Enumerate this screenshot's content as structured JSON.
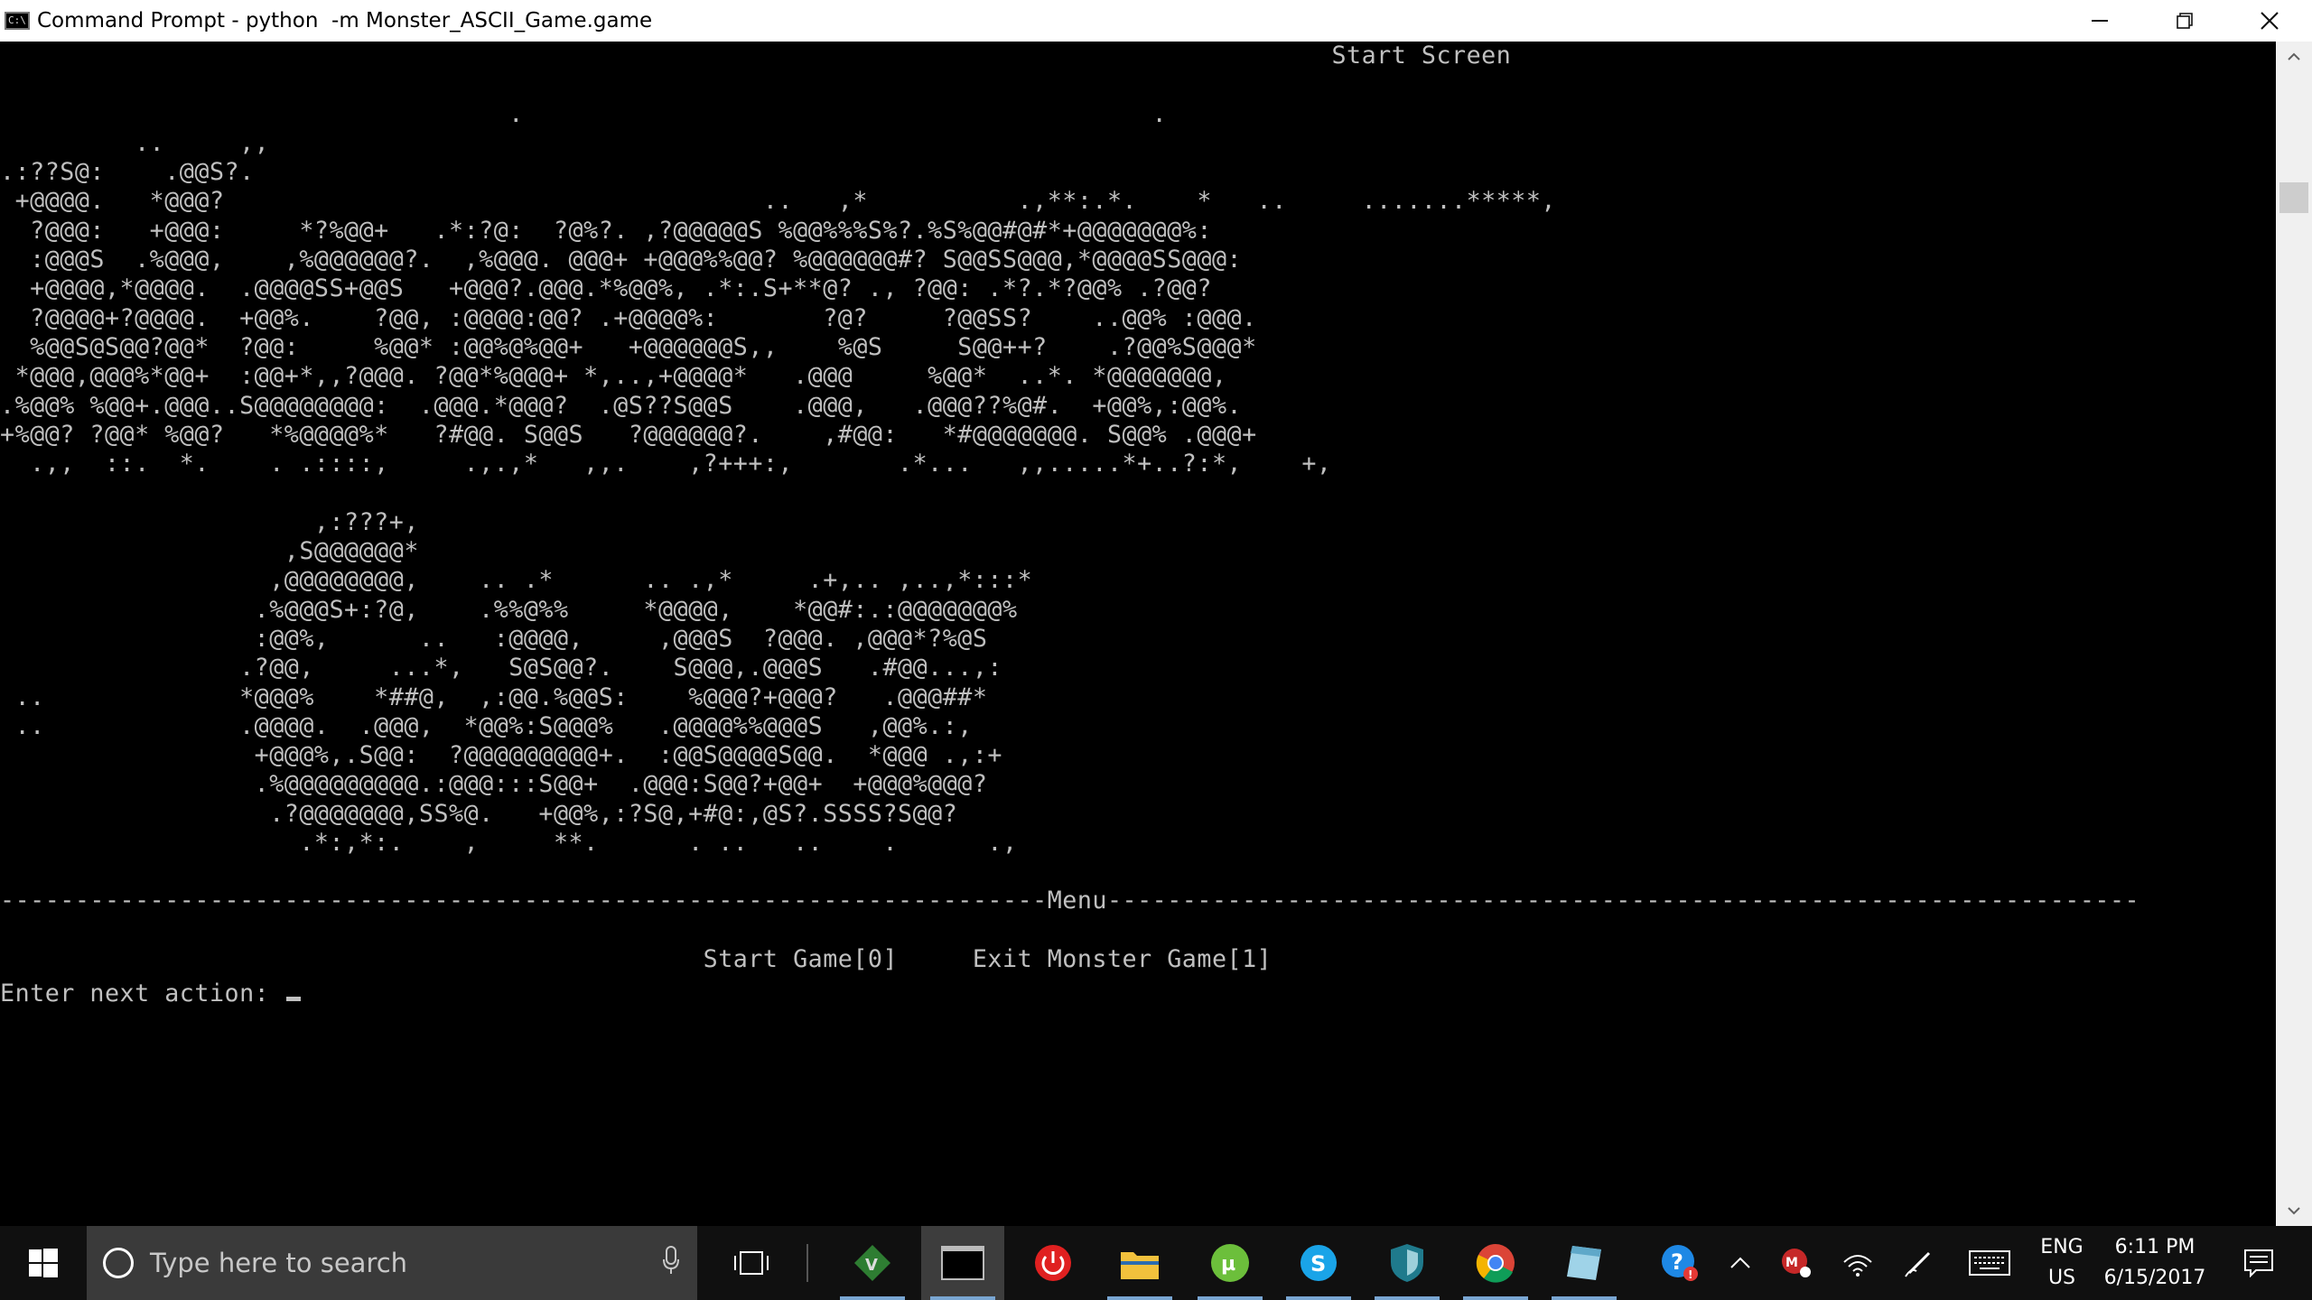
{
  "window": {
    "title": "Command Prompt - python  -m Monster_ASCII_Game.game",
    "app_icon_text": "C:\\",
    "controls": {
      "minimize_icon": "minimize-icon",
      "restore_icon": "restore-icon",
      "close_icon": "close-icon"
    }
  },
  "console": {
    "screen_title": "                                                                                         Start Screen",
    "art_top": "\n                                  .                                          .\n         ..     ,,\n.:??S@:    .@@S?.\n +@@@@.   *@@@?                                    ..   ,*          .,**:.*.    *   ..     .......*****,\n  ?@@@:   +@@@:     *?%@@+   .*:?@:  ?@%?. ,?@@@@@S %@@%%%S%?.%S%@@#@#*+@@@@@@@%:\n  :@@@S  .%@@@,    ,%@@@@@@?.  ,%@@@. @@@+ +@@@%%@@? %@@@@@@#? S@@SS@@@,*@@@@SS@@@:\n  +@@@@,*@@@@.  .@@@@SS+@@S   +@@@?.@@@.*%@@%, .*:.S+**@? ., ?@@: .*?.*?@@% .?@@?\n  ?@@@@+?@@@@.  +@@%.    ?@@, :@@@@:@@? .+@@@@%:       ?@?     ?@@SS?    ..@@% :@@@.\n  %@@S@S@@?@@*  ?@@:     %@@* :@@%@%@@+   +@@@@@@S,,    %@S     S@@++?    .?@@%S@@@*\n *@@@,@@@%*@@+  :@@+*,,?@@@. ?@@*%@@@+ *,..,+@@@@*   .@@@     %@@*  ..*. *@@@@@@@,\n.%@@% %@@+.@@@..S@@@@@@@@:  .@@@.*@@@?  .@S??S@@S    .@@@,   .@@@??%@#.  +@@%,:@@%.\n+%@@? ?@@* %@@?   *%@@@@%*   ?#@@. S@@S   ?@@@@@@?.    ,#@@:   *#@@@@@@@. S@@% .@@@+\n  .,,  ::.  *.    . .::::,     .,.,*   ,,.    ,?+++:,       .*...   ,,.....*+..?:*,    +,",
    "art_bottom": "\n                     ,:???+,\n                   ,S@@@@@@*\n                  ,@@@@@@@@,    .. .*      .. .,*     .+,.. ,..,*:::*\n                 .%@@@S+:?@,    .%%@%%     *@@@@,    *@@#:.:@@@@@@@%\n                 :@@%,      ..   :@@@@,     ,@@@S  ?@@@. ,@@@*?%@S\n                .?@@,     ...*,   S@S@@?.    S@@@,.@@@S   .#@@...,:\n ..             *@@@%    *##@,  ,:@@.%@@S:    %@@@?+@@@?   .@@@##*\n ..             .@@@@.  .@@@,  *@@%:S@@@%   .@@@@%%@@@S   ,@@%.:,\n                 +@@@%,.S@@:  ?@@@@@@@@@+.  :@@S@@@@S@@.  *@@@ .,:+\n                 .%@@@@@@@@@.:@@@:::S@@+  .@@@:S@@?+@@+  +@@@%@@@?\n                  .?@@@@@@@,SS%@.   +@@%,:?S@,+#@:,@S?.SSSS?S@@?\n                    .*:,*:.    ,     **.      . ..   ..    .      .,",
    "menu_rule": "----------------------------------------------------------------------Menu---------------------------------------------------------------------",
    "menu_options": "                                               Start Game[0]     Exit Monster Game[1]",
    "prompt": "Enter next action: "
  },
  "scrollbar": {
    "up_icon": "scroll-up-icon",
    "down_icon": "scroll-down-icon"
  },
  "taskbar": {
    "search_placeholder": "Type here to search",
    "apps": [
      "vim",
      "command-prompt",
      "power",
      "file-explorer",
      "utorrent",
      "skype",
      "windows-defender",
      "chrome",
      "notepad"
    ],
    "tray": {
      "language_line1": "ENG",
      "language_line2": "US",
      "time": "6:11 PM",
      "date": "6/15/2017"
    }
  },
  "colors": {
    "console_bg": "#000000",
    "console_text": "#c0c0c0",
    "titlebar_bg": "#ffffff",
    "taskbar_bg": "#101010",
    "search_bg": "#3a3a3a"
  }
}
